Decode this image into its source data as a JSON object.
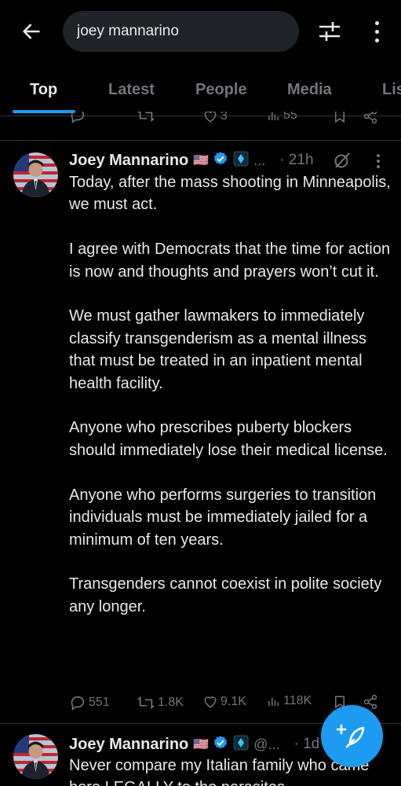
{
  "colors": {
    "background": "#000000",
    "accent": "#1d9bf0",
    "muted": "#71767b",
    "text": "#e7e9ea",
    "search_bg": "#202327"
  },
  "header": {
    "back_icon": "arrow-left-icon",
    "search_value": "joey mannarino",
    "filter_icon": "sliders-icon",
    "more_icon": "more-vertical-icon"
  },
  "tabs": [
    {
      "label": "Top",
      "active": true
    },
    {
      "label": "Latest"
    },
    {
      "label": "People"
    },
    {
      "label": "Media"
    },
    {
      "label": "Lis"
    }
  ],
  "previous_tweet": {
    "reply": "",
    "retweet": "",
    "like": "3",
    "views": "55"
  },
  "tweets": [
    {
      "author": "Joey Mannarino",
      "flag": "🇺🇸",
      "handle": "...",
      "time": "· 21h",
      "text": "Today, after the mass shooting in Minneapolis, we must act.\n\nI agree with Democrats that the time for action is now and thoughts and prayers won’t cut it.\n\nWe must gather lawmakers to immediately classify transgenderism as a mental illness that must be treated in an inpatient mental health facility.\n\nAnyone who prescribes puberty blockers should immediately lose their medical license.\n\nAnyone who performs surgeries to transition individuals must be immediately jailed for a minimum of ten years.\n\nTransgenders cannot coexist in polite society any longer.",
      "replies": "551",
      "retweets": "1.8K",
      "likes": "9.1K",
      "views": "118K"
    },
    {
      "author": "Joey Mannarino",
      "flag": "🇺🇸",
      "handle": "@...",
      "time": "· 1d",
      "text": "Never compare my Italian family who came here LEGALLY to the parasites"
    }
  ],
  "fab": {
    "icon": "compose-feather-icon"
  }
}
